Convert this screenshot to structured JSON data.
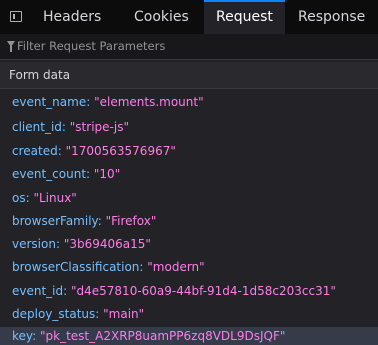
{
  "tabs": [
    {
      "label": "Headers"
    },
    {
      "label": "Cookies"
    },
    {
      "label": "Request"
    },
    {
      "label": "Response"
    }
  ],
  "filter": {
    "placeholder": "Filter Request Parameters"
  },
  "section": {
    "title": "Form data"
  },
  "params": [
    {
      "key": "event_name",
      "value": "\"elements.mount\""
    },
    {
      "key": "client_id",
      "value": "\"stripe-js\""
    },
    {
      "key": "created",
      "value": "\"1700563576967\""
    },
    {
      "key": "event_count",
      "value": "\"10\""
    },
    {
      "key": "os",
      "value": "\"Linux\""
    },
    {
      "key": "browserFamily",
      "value": "\"Firefox\""
    },
    {
      "key": "version",
      "value": "\"3b69406a15\""
    },
    {
      "key": "browserClassification",
      "value": "\"modern\""
    },
    {
      "key": "event_id",
      "value": "\"d4e57810-60a9-44bf-91d4-1d58c203cc31\""
    },
    {
      "key": "deploy_status",
      "value": "\"main\""
    },
    {
      "key": "key",
      "value": "\"pk_test_A2XRP8uamPP6zq8VDL9DsJQF\""
    }
  ],
  "colors": {
    "param_key": "#75bfff",
    "param_value": "#ff7de9",
    "selected_tab_accent": "#0a84ff"
  }
}
